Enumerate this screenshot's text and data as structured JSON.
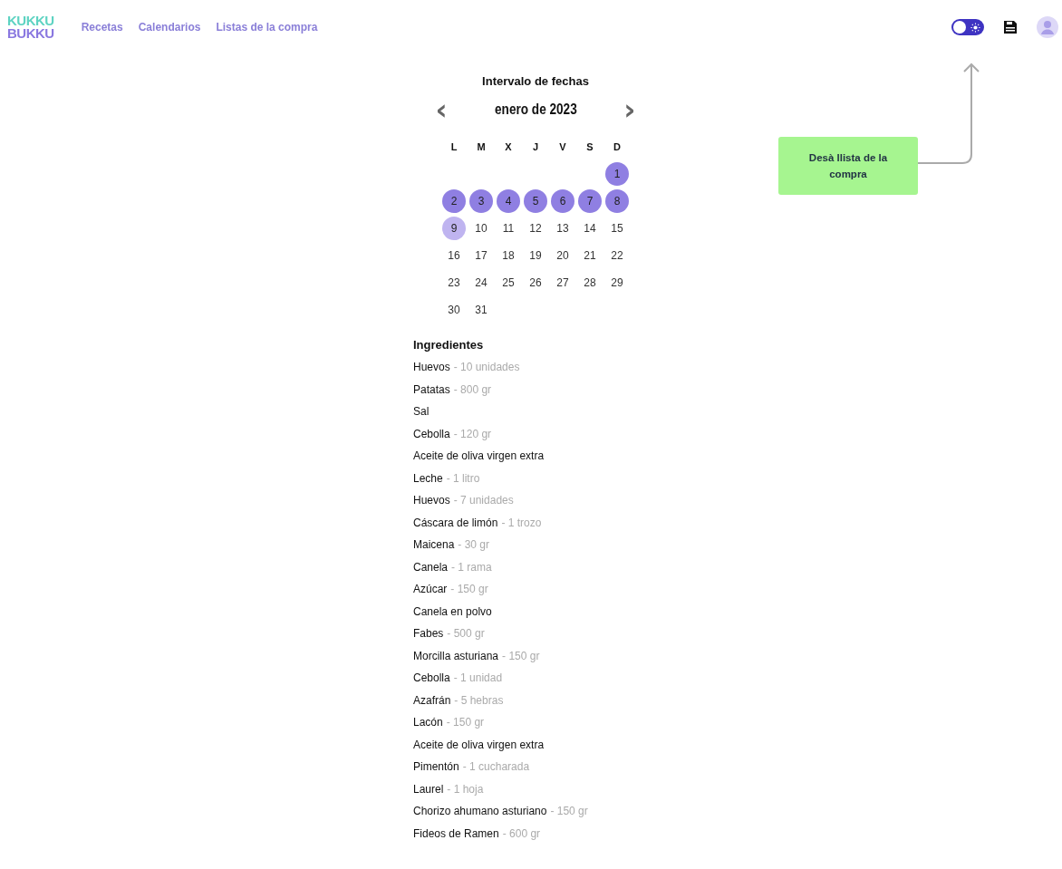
{
  "logo": {
    "line1": "KUKKU",
    "line2": "BUKKU"
  },
  "nav": [
    {
      "label": "Recetas"
    },
    {
      "label": "Calendarios"
    },
    {
      "label": "Listas de la compra"
    }
  ],
  "theme_toggle": {
    "dark_mode": false
  },
  "tooltip": {
    "text": "Desà llista de la compra"
  },
  "calendar": {
    "title": "Intervalo de fechas",
    "month": "enero de 2023",
    "prev": "‹",
    "next": "›",
    "weekdays": [
      "L",
      "M",
      "X",
      "J",
      "V",
      "S",
      "D"
    ],
    "weeks": [
      [
        {
          "d": "1",
          "selected": true,
          "hovered": false
        }
      ],
      [
        {
          "d": "2",
          "selected": true,
          "hovered": false
        },
        {
          "d": "3",
          "selected": true,
          "hovered": false
        },
        {
          "d": "4",
          "selected": true,
          "hovered": false
        },
        {
          "d": "5",
          "selected": true,
          "hovered": false
        },
        {
          "d": "6",
          "selected": true,
          "hovered": false
        },
        {
          "d": "7",
          "selected": true,
          "hovered": false
        },
        {
          "d": "8",
          "selected": true,
          "hovered": false
        }
      ],
      [
        {
          "d": "9",
          "selected": false,
          "hovered": true
        },
        {
          "d": "10",
          "selected": false,
          "hovered": false
        },
        {
          "d": "11",
          "selected": false,
          "hovered": false
        },
        {
          "d": "12",
          "selected": false,
          "hovered": false
        },
        {
          "d": "13",
          "selected": false,
          "hovered": false
        },
        {
          "d": "14",
          "selected": false,
          "hovered": false
        },
        {
          "d": "15",
          "selected": false,
          "hovered": false
        }
      ],
      [
        {
          "d": "16",
          "selected": false,
          "hovered": false
        },
        {
          "d": "17",
          "selected": false,
          "hovered": false
        },
        {
          "d": "18",
          "selected": false,
          "hovered": false
        },
        {
          "d": "19",
          "selected": false,
          "hovered": false
        },
        {
          "d": "20",
          "selected": false,
          "hovered": false
        },
        {
          "d": "21",
          "selected": false,
          "hovered": false
        },
        {
          "d": "22",
          "selected": false,
          "hovered": false
        }
      ],
      [
        {
          "d": "23",
          "selected": false,
          "hovered": false
        },
        {
          "d": "24",
          "selected": false,
          "hovered": false
        },
        {
          "d": "25",
          "selected": false,
          "hovered": false
        },
        {
          "d": "26",
          "selected": false,
          "hovered": false
        },
        {
          "d": "27",
          "selected": false,
          "hovered": false
        },
        {
          "d": "28",
          "selected": false,
          "hovered": false
        },
        {
          "d": "29",
          "selected": false,
          "hovered": false
        }
      ],
      [
        {
          "d": "30",
          "selected": false,
          "hovered": false
        },
        {
          "d": "31",
          "selected": false,
          "hovered": false
        }
      ]
    ]
  },
  "ingredients": {
    "title": "Ingredientes",
    "items": [
      {
        "name": "Huevos",
        "amount": "- 10 unidades"
      },
      {
        "name": "Patatas",
        "amount": "- 800 gr"
      },
      {
        "name": "Sal"
      },
      {
        "name": "Cebolla",
        "amount": "- 120 gr"
      },
      {
        "name": "Aceite de oliva virgen extra"
      },
      {
        "name": "Leche",
        "amount": "- 1 litro"
      },
      {
        "name": "Huevos",
        "amount": "- 7 unidades"
      },
      {
        "name": "Cáscara de limón",
        "amount": "- 1 trozo"
      },
      {
        "name": "Maicena",
        "amount": "- 30 gr"
      },
      {
        "name": "Canela",
        "amount": "- 1 rama"
      },
      {
        "name": "Azúcar",
        "amount": "- 150 gr"
      },
      {
        "name": "Canela en polvo"
      },
      {
        "name": "Fabes",
        "amount": "- 500 gr"
      },
      {
        "name": "Morcilla asturiana",
        "amount": "- 150 gr"
      },
      {
        "name": "Cebolla",
        "amount": "- 1 unidad"
      },
      {
        "name": "Azafrán",
        "amount": "- 5 hebras"
      },
      {
        "name": "Lacón",
        "amount": "- 150 gr"
      },
      {
        "name": "Aceite de oliva virgen extra"
      },
      {
        "name": "Pimentón",
        "amount": "- 1 cucharada"
      },
      {
        "name": "Laurel",
        "amount": "- 1 hoja"
      },
      {
        "name": "Chorizo ahumano asturiano",
        "amount": "- 150 gr"
      },
      {
        "name": "Fideos de Ramen",
        "amount": "- 600 gr"
      }
    ]
  }
}
